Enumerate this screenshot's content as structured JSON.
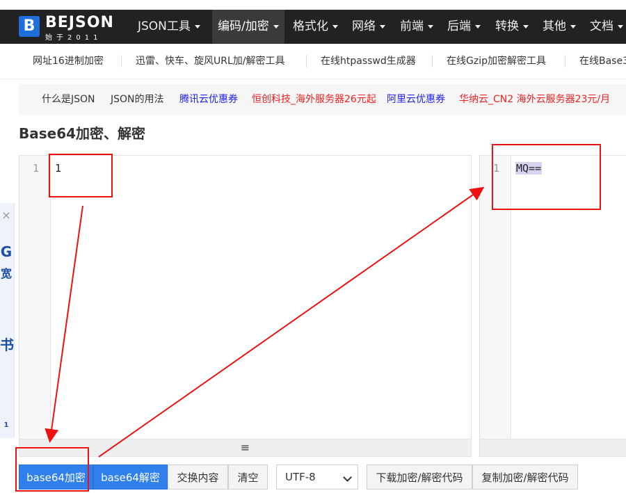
{
  "logo": {
    "mark": "B",
    "name": "BEJSON",
    "tagline": "始于2011"
  },
  "nav": [
    {
      "label": "JSON工具"
    },
    {
      "label": "编码/加密"
    },
    {
      "label": "格式化"
    },
    {
      "label": "网络"
    },
    {
      "label": "前端"
    },
    {
      "label": "后端"
    },
    {
      "label": "转换"
    },
    {
      "label": "其他"
    },
    {
      "label": "文档"
    }
  ],
  "sublinks": [
    "网址16进制加密",
    "迅雷、快车、旋风URL加/解密工具",
    "在线htpasswd生成器",
    "在线Gzip加密解密工具",
    "在线Base3"
  ],
  "adlinks": [
    {
      "label": "什么是JSON",
      "color": "#333333"
    },
    {
      "label": "JSON的用法",
      "color": "#333333"
    },
    {
      "label": "腾讯云优惠券",
      "color": "#2222ee"
    },
    {
      "label": "恒创科技_海外服务器26元起",
      "color": "#ee2222"
    },
    {
      "label": "阿里云优惠券",
      "color": "#2222ee"
    },
    {
      "label": "华纳云_CN2 海外云服务器23元/月",
      "color": "#ee2222"
    }
  ],
  "page_title": "Base64加密、解密",
  "input_editor": {
    "line_number": "1",
    "content": "1"
  },
  "output_editor": {
    "line_number": "1",
    "content": "MQ=="
  },
  "side_ad": {
    "close": "×",
    "chars": [
      "G",
      "宽",
      "书",
      "1"
    ]
  },
  "resize_grip": "≡",
  "buttons": {
    "encode": "base64加密",
    "decode": "base64解密",
    "swap": "交换内容",
    "clear": "清空",
    "download": "下载加密/解密代码",
    "copy": "复制加密/解密代码"
  },
  "charset_select": {
    "selected": "UTF-8"
  },
  "colors": {
    "annotation": "#ee1111",
    "primary_button": "#2f80ed",
    "nav_bg": "#222222"
  }
}
